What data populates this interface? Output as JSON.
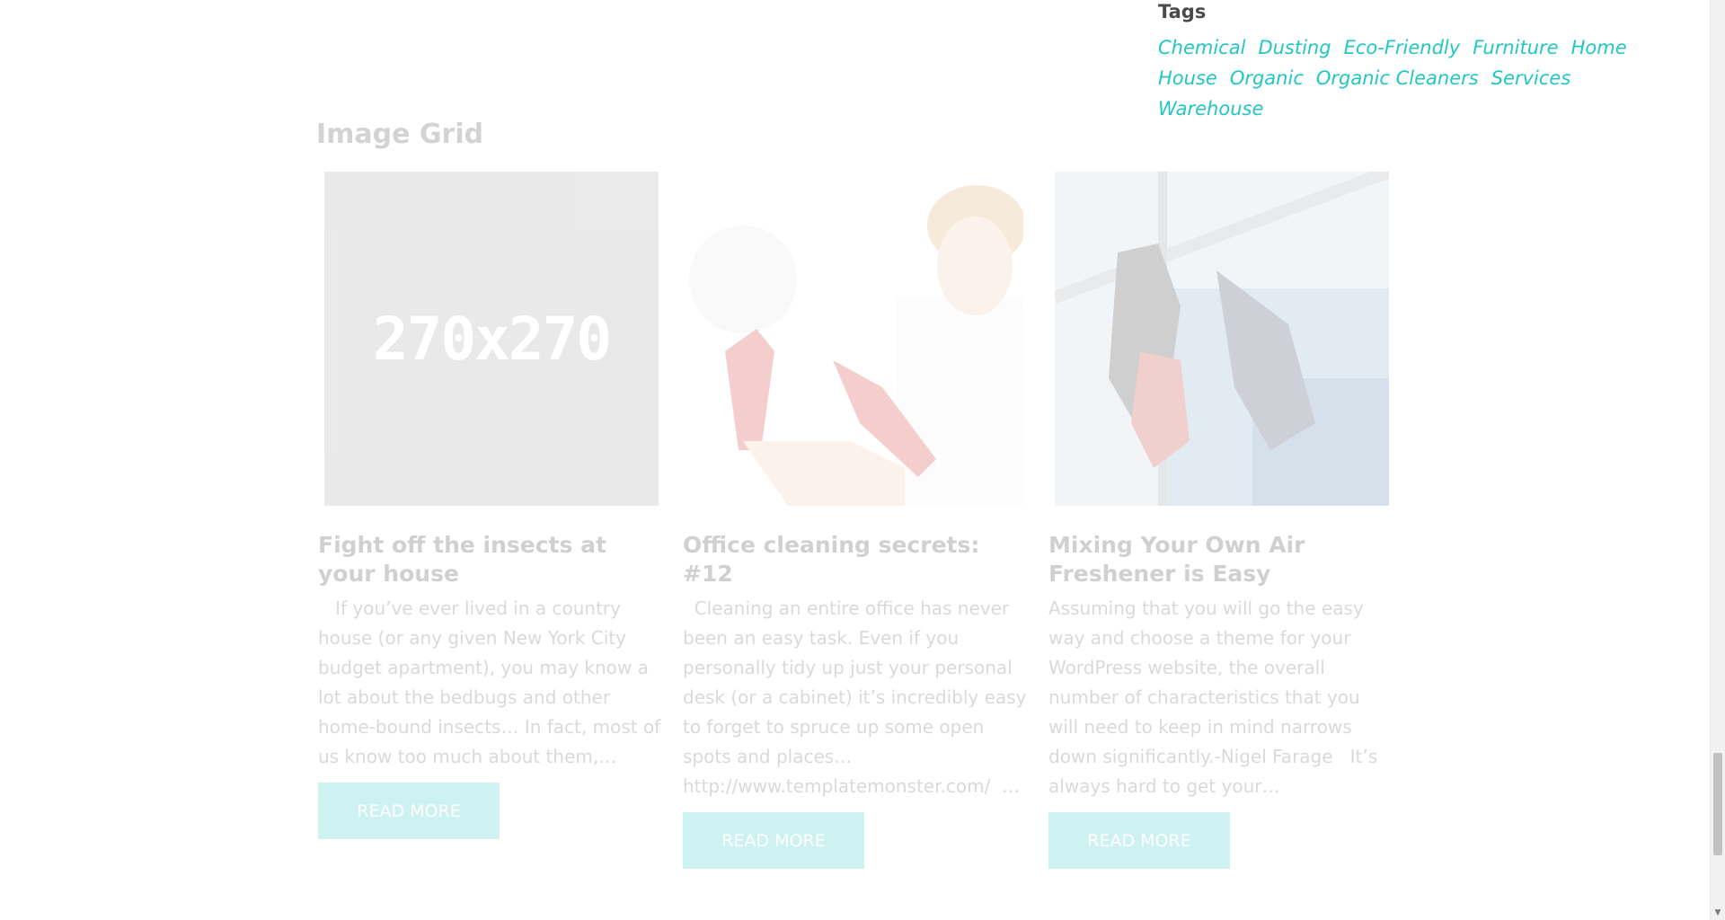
{
  "tags_widget": {
    "title": "Tags",
    "tags": [
      "Chemical",
      "Dusting",
      "Eco-Friendly",
      "Furniture",
      "Home",
      "House",
      "Organic",
      "Organic Cleaners",
      "Services",
      "Warehouse"
    ]
  },
  "image_grid": {
    "heading": "Image Grid",
    "posts": [
      {
        "image_label": "270x270",
        "title": "Fight off the insects at your house",
        "excerpt": "   If you’ve ever lived in a country house (or any given New York City budget apartment), you may know a lot about the bedbugs and other home-bound insects… In fact, most of us know too much about them,…",
        "button": "READ MORE"
      },
      {
        "image_label": "",
        "title": "Office cleaning secrets: #12",
        "excerpt": "  Cleaning an entire office has never been an easy task. Even if you personally tidy up just your personal desk (or a cabinet) it’s incredibly easy to forget to spruce up some open spots and places… http://www.templatemonster.com/  …",
        "button": "READ MORE"
      },
      {
        "image_label": "",
        "title": "Mixing Your Own Air Freshener is Easy",
        "excerpt": "Assuming that you will go the easy way and choose a theme for your WordPress website, the overall number of characteristics that you will need to keep in mind narrows down significantly.-Nigel Farage   It’s always hard to get your…",
        "button": "READ MORE"
      }
    ]
  },
  "colors": {
    "accent": "#22c7c3",
    "placeholder": "#9e9e9e"
  }
}
